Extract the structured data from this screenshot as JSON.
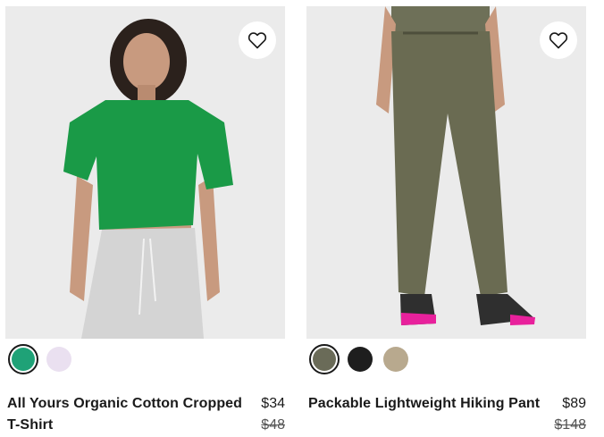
{
  "products": [
    {
      "name": "All Yours Organic Cotton Cropped T-Shirt",
      "price": "$34",
      "original_price": "$48",
      "wishlist_icon": "heart-outline-icon",
      "swatches": [
        {
          "color": "#1fa277",
          "selected": true
        },
        {
          "color": "#eae0f0",
          "selected": false
        }
      ]
    },
    {
      "name": "Packable Lightweight Hiking Pant",
      "price": "$89",
      "original_price": "$148",
      "wishlist_icon": "heart-outline-icon",
      "swatches": [
        {
          "color": "#6a6b58",
          "selected": true
        },
        {
          "color": "#1e1e1e",
          "selected": false
        },
        {
          "color": "#b8a98e",
          "selected": false
        }
      ]
    }
  ]
}
